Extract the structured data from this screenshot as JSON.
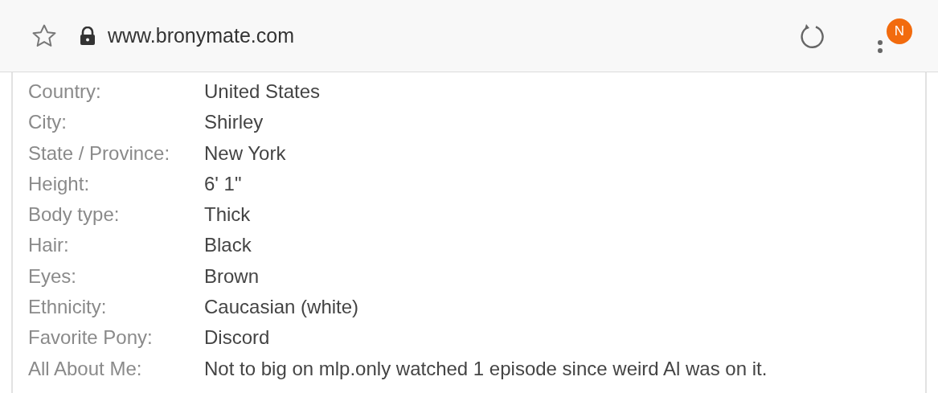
{
  "address_bar": {
    "url": "www.bronymate.com",
    "secure": true
  },
  "menu_badge": "N",
  "profile": [
    {
      "label": "Country:",
      "value": "United States"
    },
    {
      "label": "City:",
      "value": "Shirley"
    },
    {
      "label": "State / Province:",
      "value": "New York"
    },
    {
      "label": "Height:",
      "value": "6' 1\""
    },
    {
      "label": "Body type:",
      "value": "Thick"
    },
    {
      "label": "Hair:",
      "value": "Black"
    },
    {
      "label": "Eyes:",
      "value": "Brown"
    },
    {
      "label": "Ethnicity:",
      "value": "Caucasian (white)"
    },
    {
      "label": "Favorite Pony:",
      "value": "Discord"
    },
    {
      "label": "All About Me:",
      "value": "Not to big on mlp.only watched 1 episode since weird Al was on it."
    }
  ]
}
